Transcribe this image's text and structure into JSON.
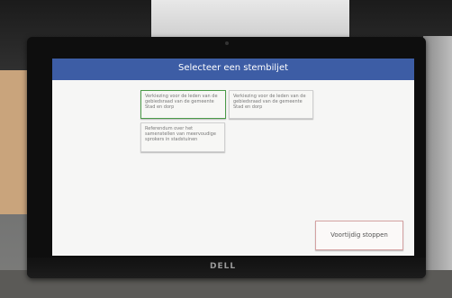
{
  "screen": {
    "title": "Selecteer een stembiljet",
    "ballots": [
      "Verkiezing voor de leden van de gebiedsraad van de gemeente Stad en dorp",
      "Verkiezing voor de leden van de gebiedsraad van de gemeente Stad en dorp",
      "Referendum over het samenstellen van meervoudige sprokers in stadstuinen"
    ],
    "stop_button": "Voortijdig stoppen"
  },
  "monitor": {
    "brand": "DELL"
  },
  "colors": {
    "header": "#3d5da5",
    "selected_border": "#4a9a48",
    "stop_border": "#d4a2a2"
  }
}
